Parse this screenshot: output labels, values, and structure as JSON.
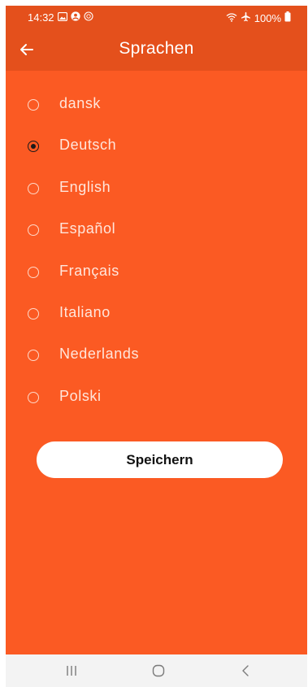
{
  "status_bar": {
    "time": "14:32",
    "battery": "100%"
  },
  "app_bar": {
    "title": "Sprachen",
    "back_icon": "arrow-left-icon"
  },
  "languages": [
    {
      "label": "dansk",
      "selected": false
    },
    {
      "label": "Deutsch",
      "selected": true
    },
    {
      "label": "English",
      "selected": false
    },
    {
      "label": "Español",
      "selected": false
    },
    {
      "label": "Français",
      "selected": false
    },
    {
      "label": "Italiano",
      "selected": false
    },
    {
      "label": "Nederlands",
      "selected": false
    },
    {
      "label": "Polski",
      "selected": false
    }
  ],
  "save_label": "Speichern",
  "colors": {
    "header": "#e4501c",
    "background": "#fb5a23",
    "button": "#ffffff",
    "nav_bar": "#f3f3f3"
  },
  "nav_bar": {
    "icons": [
      "recent-apps-icon",
      "home-icon",
      "back-icon"
    ]
  }
}
